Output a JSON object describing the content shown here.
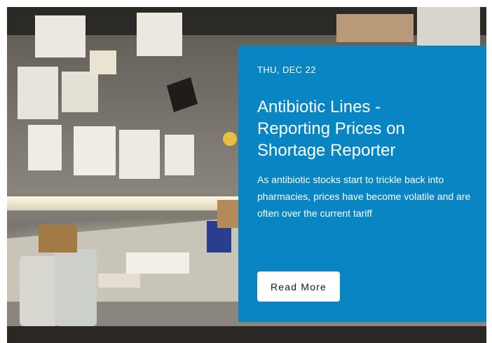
{
  "article": {
    "date": "THU, DEC 22",
    "title": "Antibiotic Lines - Reporting Prices on Shortage Reporter",
    "excerpt": "As antibiotic stocks start to trickle back into pharmacies, prices have become volatile and are often over the current tariff",
    "button_label": "Read More"
  },
  "colors": {
    "card_background": "#0786c3",
    "button_background": "#ffffff",
    "text_on_card": "#ffffff"
  }
}
